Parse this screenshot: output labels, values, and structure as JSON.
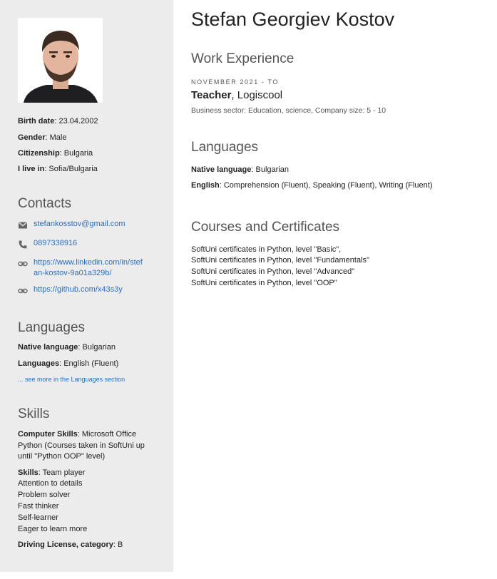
{
  "person": {
    "name": "Stefan Georgiev Kostov"
  },
  "sidebar": {
    "info": [
      {
        "label": "Birth date",
        "value": "23.04.2002"
      },
      {
        "label": "Gender",
        "value": "Male"
      },
      {
        "label": "Citizenship",
        "value": "Bulgaria"
      },
      {
        "label": "I live in",
        "value": "Sofia/Bulgaria"
      }
    ],
    "contacts_heading": "Contacts",
    "contacts": {
      "email": "stefankosstov@gmail.com",
      "phone": "0897338916",
      "linkedin_line1": "https://www.linkedin.com/in/stef",
      "linkedin_line2": "an-kostov-9a01a329b/",
      "github": "https://github.com/x43s3y"
    },
    "languages_heading": "Languages",
    "native_label": "Native language",
    "native_value": "Bulgarian",
    "languages_label": "Languages",
    "languages_value": "English (Fluent)",
    "see_more": "... see more in the Languages section",
    "skills_heading": "Skills",
    "computer_label": "Computer Skills",
    "computer_lines": [
      ": Microsoft Office",
      "Python (Courses taken in SoftUni up",
      "until \"Python OOP\" level)"
    ],
    "skills_label": "Skills",
    "skills_lines": [
      ": Team player",
      "Attention to details",
      "Problem solver",
      "Fast thinker",
      "Self-learner",
      "Eager to learn more"
    ],
    "driving_label": "Driving License, category",
    "driving_value": "B"
  },
  "main": {
    "work_heading": "Work Experience",
    "work": {
      "date": "NOVEMBER 2021 - TO",
      "position": "Teacher",
      "company": "Logiscool",
      "sector": "Business sector: Education, science, Company size: 5 - 10"
    },
    "languages_heading": "Languages",
    "native_label": "Native language",
    "native_value": "Bulgarian",
    "english_label": "English",
    "english_value": "Comprehension (Fluent), Speaking (Fluent), Writing (Fluent)",
    "courses_heading": "Courses and Certificates",
    "courses": [
      "SoftUni certificates in Python, level \"Basic\",",
      "SoftUni certificates in Python, level \"Fundamentals\"",
      "SoftUni certificates in Python, level \"Advanced\"",
      "SoftUni certificates in Python, level \"OOP\""
    ]
  },
  "icons": {
    "email": "envelope-icon",
    "phone": "phone-icon",
    "link": "link-icon"
  },
  "colors": {
    "sidebar_bg": "#ececec",
    "link": "#2a6fbf"
  }
}
